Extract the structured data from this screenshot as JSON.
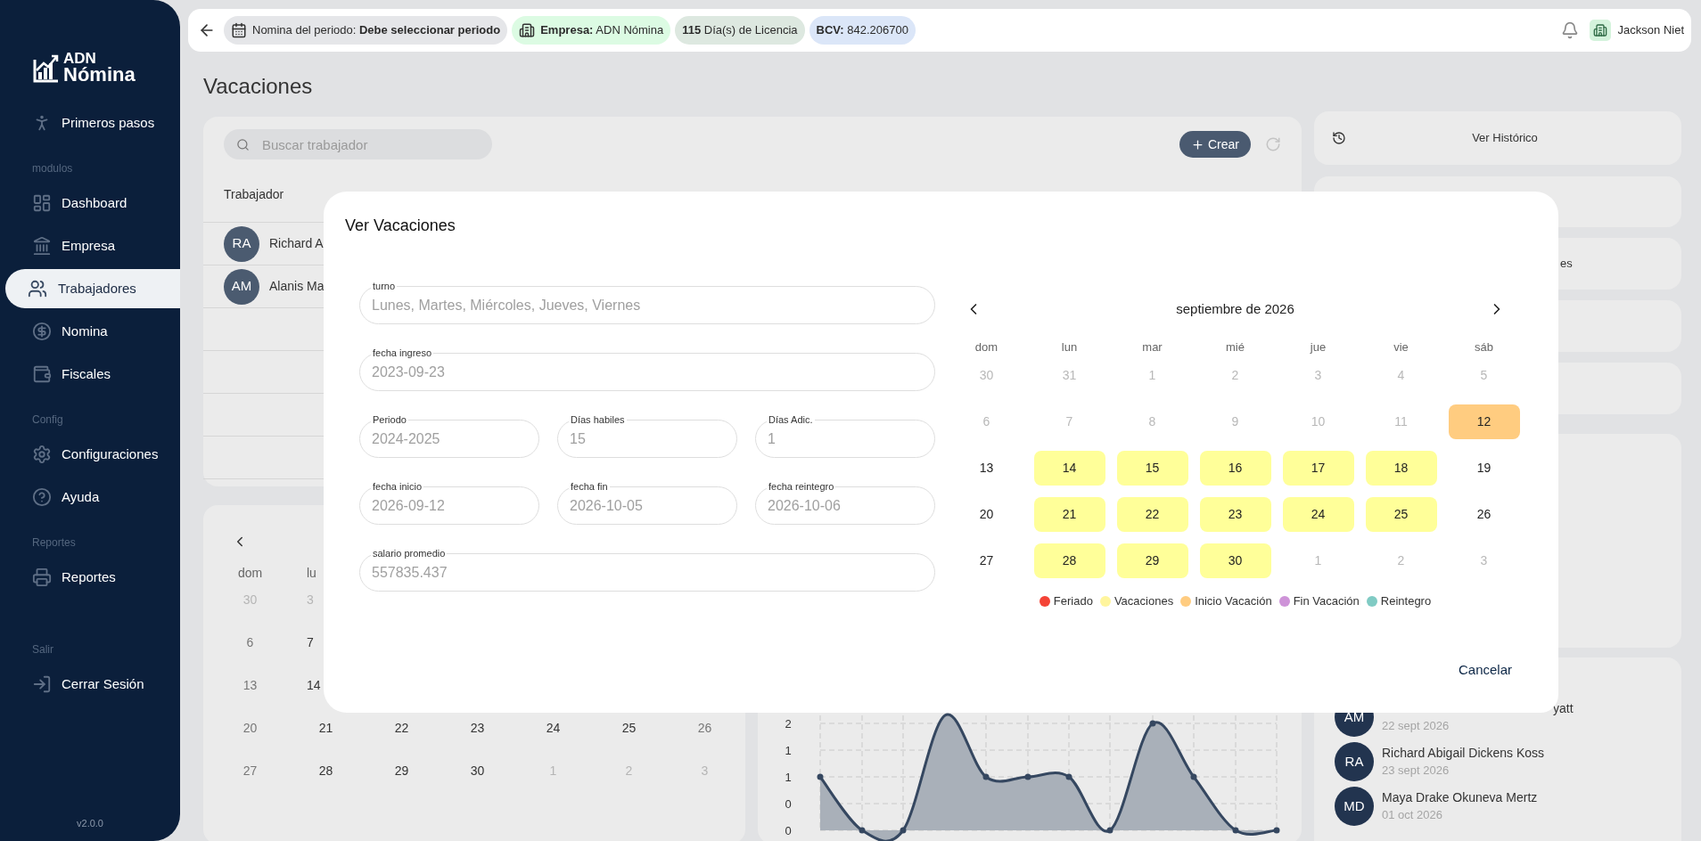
{
  "sidebar": {
    "logo": {
      "top": "ADN",
      "bottom": "Nómina"
    },
    "items": [
      {
        "kind": "link",
        "label": "Primeros pasos",
        "selected": false
      },
      {
        "kind": "section",
        "label": "modulos"
      },
      {
        "kind": "link",
        "label": "Dashboard",
        "selected": false
      },
      {
        "kind": "link",
        "label": "Empresa",
        "selected": false
      },
      {
        "kind": "link",
        "label": "Trabajadores",
        "selected": true
      },
      {
        "kind": "link",
        "label": "Nomina",
        "selected": false
      },
      {
        "kind": "link",
        "label": "Fiscales",
        "selected": false
      },
      {
        "kind": "section",
        "label": "Config"
      },
      {
        "kind": "link",
        "label": "Configuraciones",
        "selected": false
      },
      {
        "kind": "link",
        "label": "Ayuda",
        "selected": false
      },
      {
        "kind": "section",
        "label": "Reportes"
      },
      {
        "kind": "link",
        "label": "Reportes",
        "selected": false
      },
      {
        "kind": "section",
        "label": "Salir"
      },
      {
        "kind": "link",
        "label": "Cerrar Sesión",
        "selected": false
      }
    ],
    "version": "v2.0.0"
  },
  "top_bar": {
    "chips": [
      {
        "kind": "period",
        "text": "Nomina del periodo: **Debe seleccionar periodo**"
      },
      {
        "kind": "company",
        "text": "**Empresa:** ADN Nómina"
      },
      {
        "kind": "license",
        "text": "**115** Día(s) de Licencia"
      },
      {
        "kind": "rate",
        "text": "**BCV:** 842.206700"
      }
    ],
    "user": "Jackson Niet"
  },
  "title": "Vacaciones",
  "workers": {
    "search": {
      "placeholder": "Buscar trabajador"
    },
    "create_button": "Crear",
    "column": "Trabajador",
    "rows": [
      {
        "initials": "RA",
        "name": "Richard A"
      },
      {
        "initials": "AM",
        "name": "Alanis Ma"
      }
    ]
  },
  "calendar": {
    "weekdays": [
      "dom",
      "lu"
    ],
    "weeks": [
      [
        {
          "day": "30",
          "kind": "outside"
        },
        {
          "day": "3",
          "kind": "outside"
        }
      ],
      [
        {
          "day": "6",
          "kind": "weekend"
        },
        {
          "day": "7",
          "kind": "weekday"
        }
      ],
      [
        {
          "day": "13",
          "kind": "weekend"
        },
        {
          "day": "14",
          "kind": "weekday"
        }
      ],
      [
        {
          "day": "20",
          "kind": "weekend"
        },
        {
          "day": "21",
          "kind": "weekday"
        },
        {
          "day": "22",
          "kind": "weekday"
        },
        {
          "day": "23",
          "kind": "weekday"
        },
        {
          "day": "24",
          "kind": "weekday"
        },
        {
          "day": "25",
          "kind": "weekday"
        },
        {
          "day": "26",
          "kind": "weekend"
        }
      ],
      [
        {
          "day": "27",
          "kind": "weekend"
        },
        {
          "day": "28",
          "kind": "weekday"
        },
        {
          "day": "29",
          "kind": "weekday"
        },
        {
          "day": "30",
          "kind": "weekday"
        },
        {
          "day": "1",
          "kind": "outside"
        },
        {
          "day": "2",
          "kind": "outside"
        },
        {
          "day": "3",
          "kind": "outside"
        }
      ]
    ]
  },
  "chart": {
    "y_labels": [
      "2",
      "1",
      "1",
      "0",
      "0"
    ]
  },
  "side": {
    "history_button": "Ver Histórico",
    "card_text": "es",
    "recent": [
      {
        "initials": "AM",
        "name": "yatt",
        "date": "22 sept 2026"
      },
      {
        "initials": "RA",
        "name": "Richard Abigail Dickens Koss",
        "date": "23 sept 2026"
      },
      {
        "initials": "MD",
        "name": "Maya Drake Okuneva Mertz",
        "date": "01 oct 2026"
      }
    ]
  },
  "modal": {
    "title": "Ver Vacaciones",
    "fields": [
      {
        "kind": "wide",
        "label": "turno",
        "value": "Lunes, Martes, Miércoles, Jueves, Viernes",
        "disabled": true
      },
      {
        "kind": "wide",
        "label": "fecha ingreso",
        "value": "2023-09-23",
        "disabled": true
      },
      {
        "kind": "narrow",
        "label": "Periodo",
        "value": "2024-2025",
        "disabled": true
      },
      {
        "kind": "narrow",
        "label": "Días habiles",
        "value": "15",
        "disabled": true
      },
      {
        "kind": "narrow",
        "label": "Días Adic.",
        "value": "1",
        "disabled": true
      },
      {
        "kind": "narrow",
        "label": "fecha inicio",
        "value": "2026-09-12",
        "disabled": true
      },
      {
        "kind": "narrow",
        "label": "fecha fin",
        "value": "2026-10-05",
        "disabled": true
      },
      {
        "kind": "narrow",
        "label": "fecha reintegro",
        "value": "2026-10-06",
        "disabled": true
      },
      {
        "kind": "wide",
        "label": "salario promedio",
        "value": "557835.437",
        "disabled": true
      }
    ],
    "calendar": {
      "month": "septiembre de 2026",
      "weekdays": [
        "dom",
        "lun",
        "mar",
        "mié",
        "jue",
        "vie",
        "sáb"
      ],
      "weeks": [
        [
          {
            "day": "30",
            "kind": "muted"
          },
          {
            "day": "31",
            "kind": "muted"
          },
          {
            "day": "1",
            "kind": "muted"
          },
          {
            "day": "2",
            "kind": "muted"
          },
          {
            "day": "3",
            "kind": "muted"
          },
          {
            "day": "4",
            "kind": "muted"
          },
          {
            "day": "5",
            "kind": "muted"
          }
        ],
        [
          {
            "day": "6",
            "kind": "muted"
          },
          {
            "day": "7",
            "kind": "muted"
          },
          {
            "day": "8",
            "kind": "muted"
          },
          {
            "day": "9",
            "kind": "muted"
          },
          {
            "day": "10",
            "kind": "muted"
          },
          {
            "day": "11",
            "kind": "muted"
          },
          {
            "day": "12",
            "kind": "start"
          }
        ],
        [
          {
            "day": "13",
            "kind": "normal"
          },
          {
            "day": "14",
            "kind": "vacation"
          },
          {
            "day": "15",
            "kind": "vacation"
          },
          {
            "day": "16",
            "kind": "vacation"
          },
          {
            "day": "17",
            "kind": "vacation"
          },
          {
            "day": "18",
            "kind": "vacation"
          },
          {
            "day": "19",
            "kind": "normal"
          }
        ],
        [
          {
            "day": "20",
            "kind": "normal"
          },
          {
            "day": "21",
            "kind": "vacation"
          },
          {
            "day": "22",
            "kind": "vacation"
          },
          {
            "day": "23",
            "kind": "vacation"
          },
          {
            "day": "24",
            "kind": "vacation"
          },
          {
            "day": "25",
            "kind": "vacation"
          },
          {
            "day": "26",
            "kind": "normal"
          }
        ],
        [
          {
            "day": "27",
            "kind": "normal"
          },
          {
            "day": "28",
            "kind": "vacation"
          },
          {
            "day": "29",
            "kind": "vacation"
          },
          {
            "day": "30",
            "kind": "vacation"
          },
          {
            "day": "1",
            "kind": "muted"
          },
          {
            "day": "2",
            "kind": "muted"
          },
          {
            "day": "3",
            "kind": "muted"
          }
        ]
      ],
      "legend": [
        {
          "label": "Feriado",
          "color": "#f44336"
        },
        {
          "label": "Vacaciones",
          "color": "#fff59d"
        },
        {
          "label": "Inicio Vacación",
          "color": "#ffcc80"
        },
        {
          "label": "Fin Vacación",
          "color": "#ce93d8"
        },
        {
          "label": "Reintegro",
          "color": "#80cbc4"
        }
      ]
    },
    "cancel_button": "Cancelar"
  }
}
